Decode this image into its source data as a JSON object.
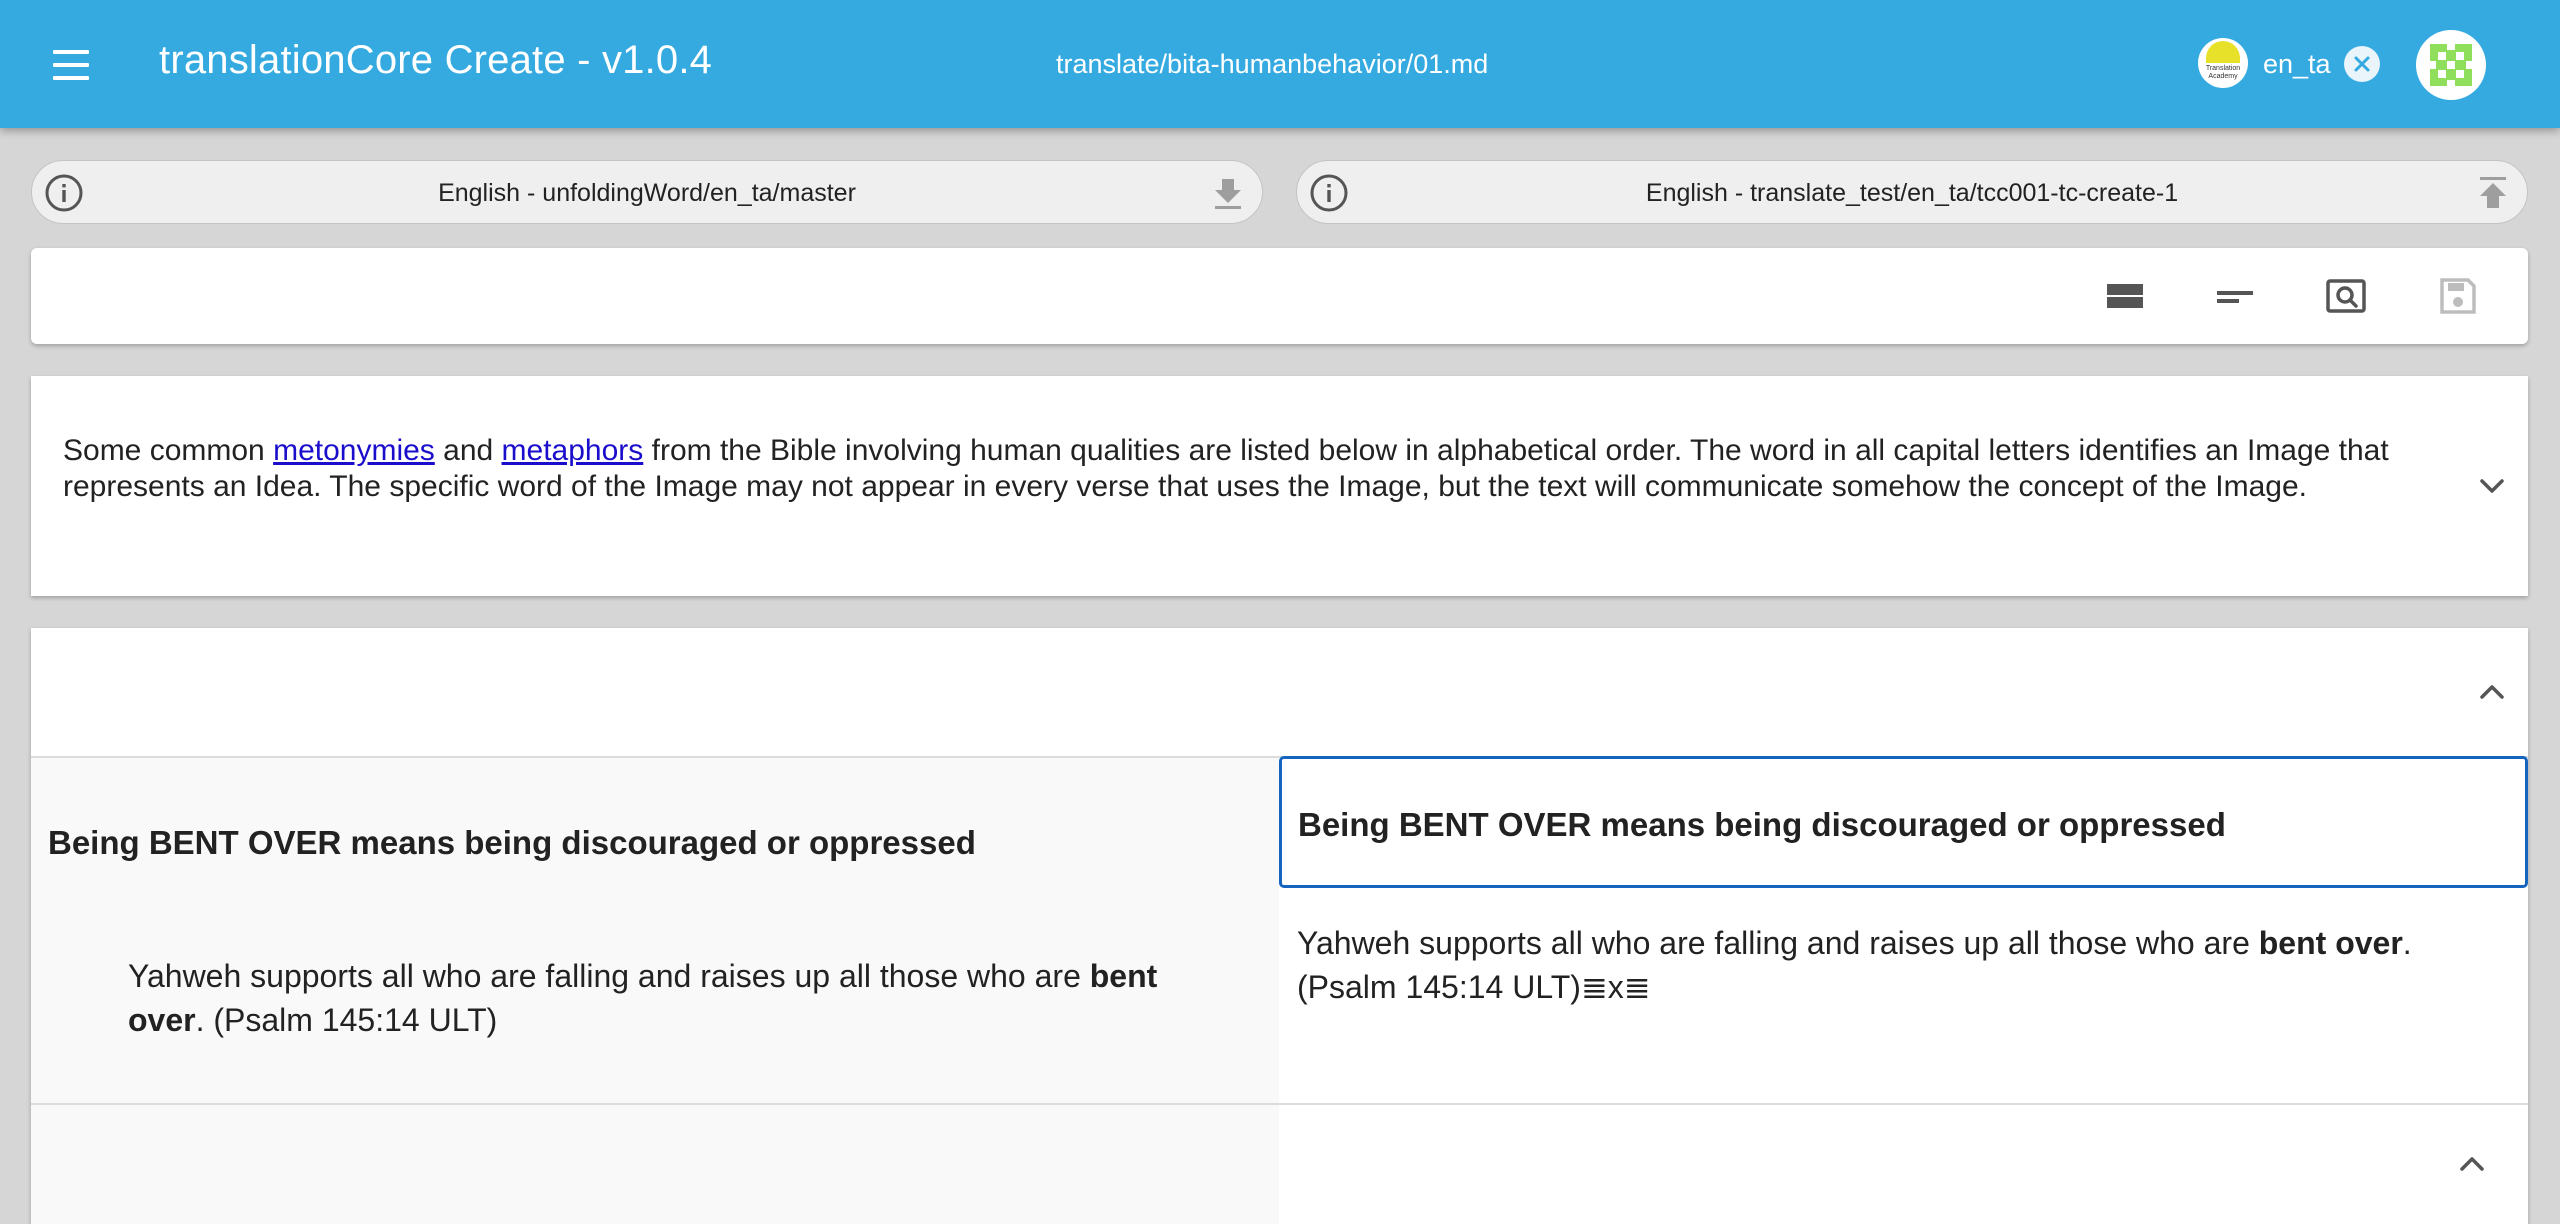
{
  "app": {
    "title": "translationCore Create - v1.0.4",
    "file_path": "translate/bita-humanbehavior/01.md",
    "language_code": "en_ta",
    "language_badge_text": "Translation Academy"
  },
  "resources": {
    "source_label": "English - unfoldingWord/en_ta/master",
    "target_label": "English - translate_test/en_ta/tcc001-tc-create-1"
  },
  "intro": {
    "text_before_link1": "Some common ",
    "link1": "metonymies",
    "text_between": " and ",
    "link2": "metaphors",
    "text_after": " from the Bible involving human qualities are listed below in alphabetical order. The word in all capital letters identifies an Image that represents an Idea. The specific word of the Image may not appear in every verse that uses the Image, but the text will communicate somehow the concept of the Image."
  },
  "section": {
    "source_heading": "Being BENT OVER means being discouraged or oppressed",
    "target_heading": "Being BENT OVER means being discouraged or oppressed",
    "source_quote_before": "Yahweh supports all who are falling and raises up all those who are ",
    "source_quote_bold": "bent over",
    "source_quote_after": ". (Psalm 145:14 ULT)",
    "target_quote_before": "Yahweh supports all who are falling and raises up all those who are ",
    "target_quote_bold": "bent over",
    "target_quote_after": ". (Psalm 145:14 ULT)",
    "target_quote_artifact": "≣x≣"
  },
  "icons": {
    "menu": "hamburger-menu-icon",
    "close": "close-circle-icon",
    "info": "info-circle-icon",
    "download": "download-icon",
    "upload": "upload-icon",
    "view_blocks": "view-blocks-icon",
    "preview": "preview-icon",
    "find": "find-icon",
    "save": "save-icon",
    "expand": "chevron-down-icon",
    "collapse": "chevron-up-icon"
  },
  "colors": {
    "appbar": "#35aae0",
    "focus_border": "#1565c0",
    "link": "#1a0dcc"
  }
}
